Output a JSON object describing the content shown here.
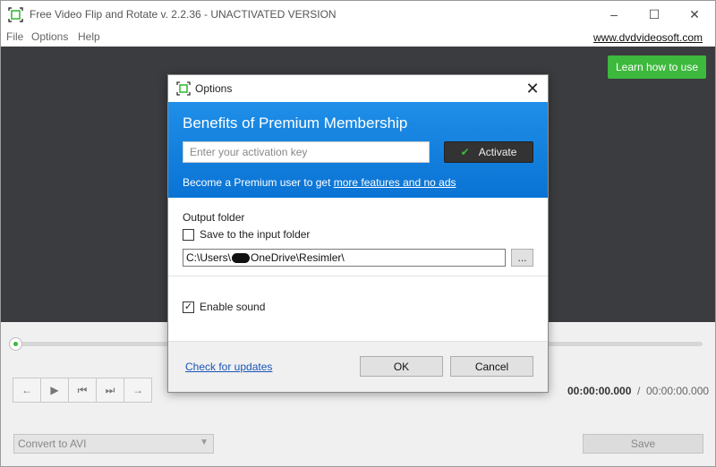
{
  "window": {
    "title": "Free Video Flip and Rotate v. 2.2.36 - UNACTIVATED VERSION",
    "minimize_glyph": "–",
    "maximize_glyph": "☐",
    "close_glyph": "✕"
  },
  "menu": {
    "items": [
      "File",
      "Options",
      "Help"
    ],
    "site_link": "www.dvdvideosoft.com"
  },
  "preview": {
    "learn_button": "Learn how to use"
  },
  "seekbar": {
    "position_fraction": 0.0
  },
  "playback": {
    "buttons": [
      {
        "icon": "arrow-left-icon",
        "glyph": "←"
      },
      {
        "icon": "play-icon",
        "glyph": "▶"
      },
      {
        "icon": "skip-start-icon",
        "glyph": "⏮"
      },
      {
        "icon": "skip-end-icon",
        "glyph": "⏭"
      },
      {
        "icon": "arrow-right-icon",
        "glyph": "→"
      }
    ],
    "current_time": "00:00:00.000",
    "separator": "/",
    "total_time": "00:00:00.000"
  },
  "bottom": {
    "format_value": "Convert to AVI",
    "save_label": "Save"
  },
  "dialog": {
    "title": "Options",
    "close_glyph": "✕",
    "premium": {
      "heading": "Benefits of Premium Membership",
      "key_placeholder": "Enter your activation key",
      "activate_label": "Activate",
      "promo_text": "Become a Premium user to get ",
      "promo_link": "more features and no ads"
    },
    "output": {
      "label": "Output folder",
      "save_to_input_label": "Save to the input folder",
      "save_to_input_checked": false,
      "path_prefix": "C:\\Users\\",
      "path_suffix": "OneDrive\\Resimler\\",
      "browse_label": "..."
    },
    "enable_sound_label": "Enable sound",
    "enable_sound_checked": true,
    "check_updates_label": "Check for updates",
    "ok_label": "OK",
    "cancel_label": "Cancel"
  },
  "colors": {
    "accent_green": "#3db93d",
    "banner_blue": "#0a73d4",
    "preview_bg": "#3a3c3f",
    "link_blue": "#1a55b8"
  }
}
